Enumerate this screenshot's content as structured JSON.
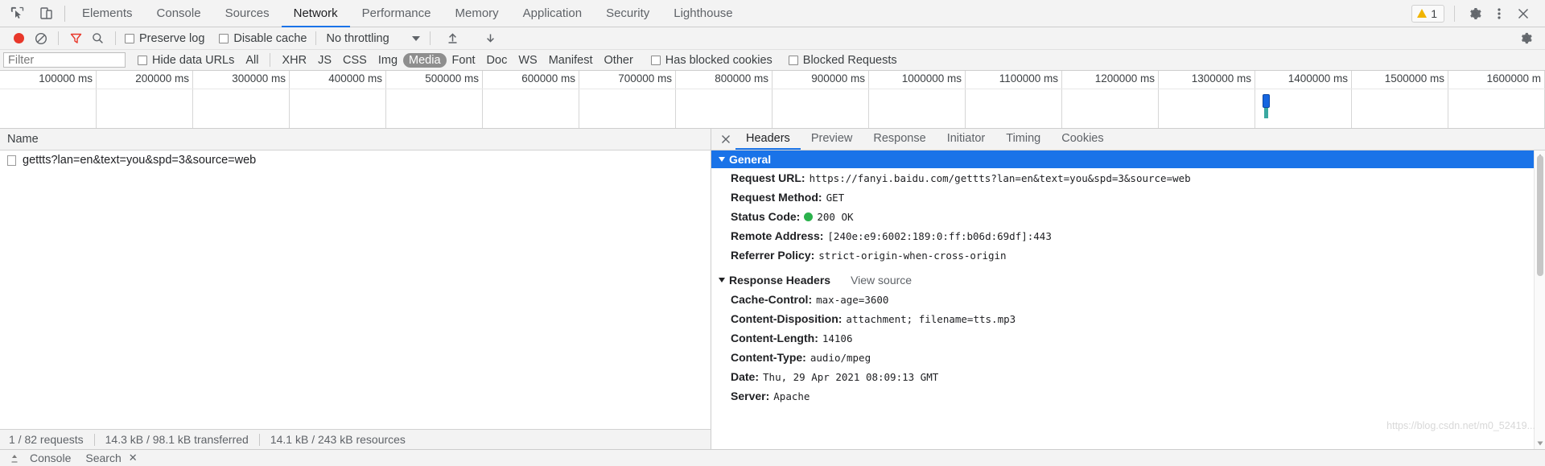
{
  "topbar": {
    "icons": [
      {
        "name": "inspect-element-icon"
      },
      {
        "name": "device-toolbar-icon"
      }
    ],
    "tabs": [
      {
        "label": "Elements",
        "active": false
      },
      {
        "label": "Console",
        "active": false
      },
      {
        "label": "Sources",
        "active": false
      },
      {
        "label": "Network",
        "active": true
      },
      {
        "label": "Performance",
        "active": false
      },
      {
        "label": "Memory",
        "active": false
      },
      {
        "label": "Application",
        "active": false
      },
      {
        "label": "Security",
        "active": false
      },
      {
        "label": "Lighthouse",
        "active": false
      }
    ],
    "warning_count": "1",
    "right_icons": [
      "gear-icon",
      "kebab-menu-icon",
      "close-icon"
    ]
  },
  "network_toolbar": {
    "record_title": "record-button",
    "clear_title": "clear-button",
    "filter_title": "filter-button",
    "search_title": "search-button",
    "preserve_log_label": "Preserve log",
    "disable_cache_label": "Disable cache",
    "throttling_label": "No throttling",
    "import_title": "import-har-button",
    "export_title": "export-har-button",
    "settings_title": "network-settings-icon"
  },
  "filter_row": {
    "filter_placeholder": "Filter",
    "filter_value": "",
    "hide_data_urls_label": "Hide data URLs",
    "types": [
      {
        "label": "All",
        "selected": false
      },
      {
        "label": "XHR",
        "selected": false
      },
      {
        "label": "JS",
        "selected": false
      },
      {
        "label": "CSS",
        "selected": false
      },
      {
        "label": "Img",
        "selected": false
      },
      {
        "label": "Media",
        "selected": true
      },
      {
        "label": "Font",
        "selected": false
      },
      {
        "label": "Doc",
        "selected": false
      },
      {
        "label": "WS",
        "selected": false
      },
      {
        "label": "Manifest",
        "selected": false
      },
      {
        "label": "Other",
        "selected": false
      }
    ],
    "has_blocked_cookies_label": "Has blocked cookies",
    "blocked_requests_label": "Blocked Requests"
  },
  "overview": {
    "ticks": [
      "100000 ms",
      "200000 ms",
      "300000 ms",
      "400000 ms",
      "500000 ms",
      "600000 ms",
      "700000 ms",
      "800000 ms",
      "900000 ms",
      "1000000 ms",
      "1100000 ms",
      "1200000 ms",
      "1300000 ms",
      "1400000 ms",
      "1500000 ms",
      "1600000 m"
    ],
    "marker_color": "#1565e0",
    "marker_position_ms": "1310000"
  },
  "request_list": {
    "column_header": "Name",
    "rows": [
      {
        "name": "gettts?lan=en&text=you&spd=3&source=web"
      }
    ]
  },
  "status_bar": {
    "requests": "1 / 82 requests",
    "transferred": "14.3 kB / 98.1 kB transferred",
    "resources": "14.1 kB / 243 kB resources"
  },
  "details": {
    "tabs": [
      {
        "label": "Headers",
        "active": true
      },
      {
        "label": "Preview",
        "active": false
      },
      {
        "label": "Response",
        "active": false
      },
      {
        "label": "Initiator",
        "active": false
      },
      {
        "label": "Timing",
        "active": false
      },
      {
        "label": "Cookies",
        "active": false
      }
    ],
    "general": {
      "section_title": "General",
      "rows": [
        {
          "key": "Request URL:",
          "value": "https://fanyi.baidu.com/gettts?lan=en&text=you&spd=3&source=web",
          "status": false
        },
        {
          "key": "Request Method:",
          "value": "GET",
          "status": false
        },
        {
          "key": "Status Code:",
          "value": "200 OK",
          "status": true
        },
        {
          "key": "Remote Address:",
          "value": "[240e:e9:6002:189:0:ff:b06d:69df]:443",
          "status": false
        },
        {
          "key": "Referrer Policy:",
          "value": "strict-origin-when-cross-origin",
          "status": false
        }
      ]
    },
    "response_headers": {
      "section_title": "Response Headers",
      "view_source_label": "View source",
      "rows": [
        {
          "key": "Cache-Control:",
          "value": "max-age=3600"
        },
        {
          "key": "Content-Disposition:",
          "value": "attachment; filename=tts.mp3"
        },
        {
          "key": "Content-Length:",
          "value": "14106"
        },
        {
          "key": "Content-Type:",
          "value": "audio/mpeg"
        },
        {
          "key": "Date:",
          "value": "Thu, 29 Apr 2021 08:09:13 GMT"
        },
        {
          "key": "Server:",
          "value": "Apache"
        }
      ]
    }
  },
  "drawer": {
    "tabs": [
      {
        "label": "Console"
      },
      {
        "label": "Search"
      }
    ],
    "close_label": "✕"
  },
  "watermark": "https://blog.csdn.net/m0_52419...",
  "colors": {
    "accent": "#1a73e8",
    "record": "#e8372a",
    "status_ok": "#2bb24c",
    "warning": "#f0b400",
    "selected_filter": "#8e8e8e"
  }
}
